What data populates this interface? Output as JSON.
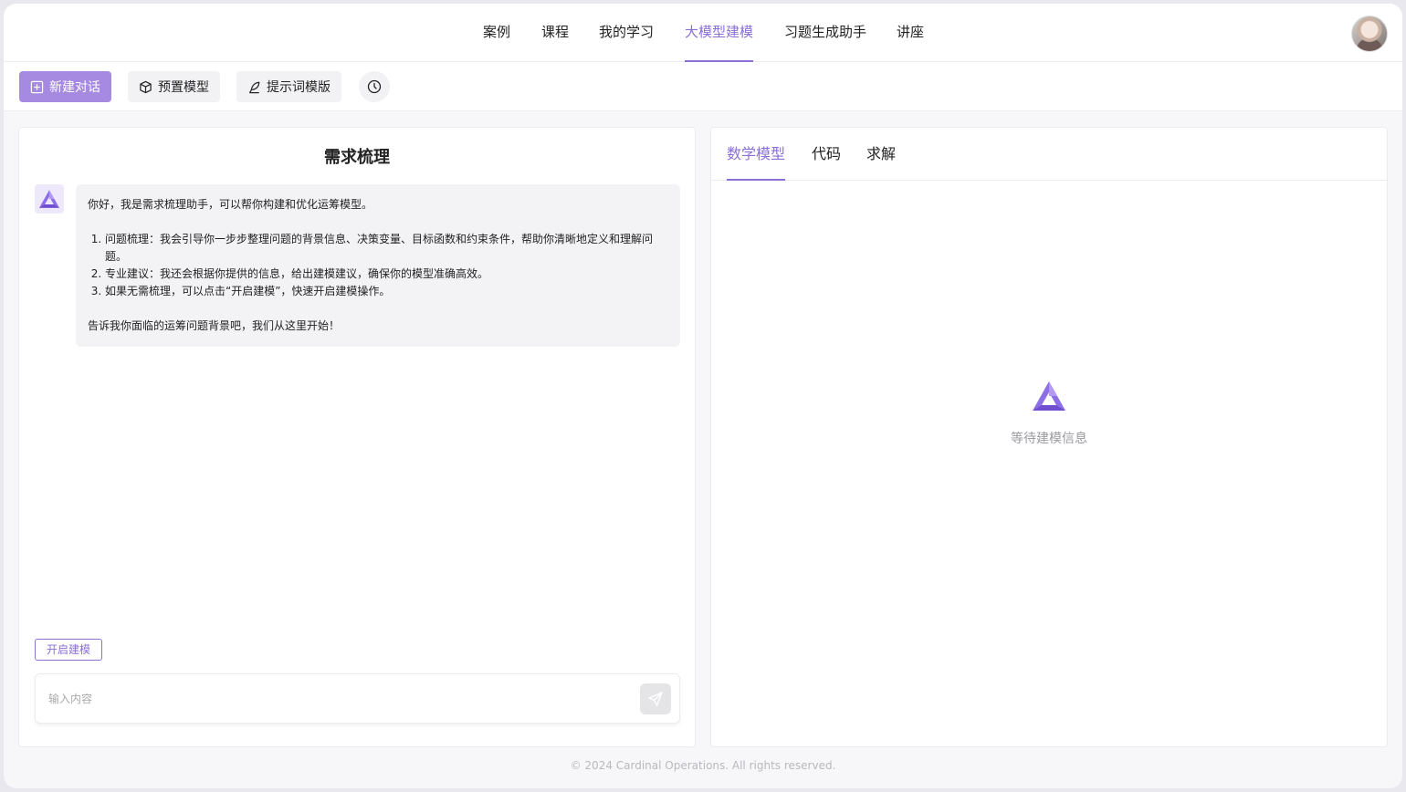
{
  "nav": {
    "items": [
      {
        "label": "案例"
      },
      {
        "label": "课程"
      },
      {
        "label": "我的学习"
      },
      {
        "label": "大模型建模",
        "active": true
      },
      {
        "label": "习题生成助手"
      },
      {
        "label": "讲座"
      }
    ]
  },
  "toolbar": {
    "new_chat_label": "新建对话",
    "preset_model_label": "预置模型",
    "prompt_template_label": "提示词模版",
    "history_icon": "clock-icon"
  },
  "chat": {
    "title": "需求梳理",
    "message": {
      "intro": "你好，我是需求梳理助手，可以帮你构建和优化运筹模型。",
      "items": [
        "问题梳理：我会引导你一步步整理问题的背景信息、决策变量、目标函数和约束条件，帮助你清晰地定义和理解问题。",
        "专业建议：我还会根据你提供的信息，给出建模建议，确保你的模型准确高效。",
        "如果无需梳理，可以点击“开启建模”，快速开启建模操作。"
      ],
      "outro": "告诉我你面临的运筹问题背景吧，我们从这里开始！"
    },
    "start_modeling_label": "开启建模",
    "input": {
      "value": "",
      "placeholder": "输入内容"
    }
  },
  "result": {
    "tabs": [
      {
        "label": "数学模型",
        "active": true
      },
      {
        "label": "代码"
      },
      {
        "label": "求解"
      }
    ],
    "empty_text": "等待建模信息"
  },
  "footer": {
    "text": "© 2024 Cardinal Operations. All rights reserved."
  },
  "colors": {
    "accent": "#8a6fd6",
    "primary_button": "#a689e0"
  }
}
